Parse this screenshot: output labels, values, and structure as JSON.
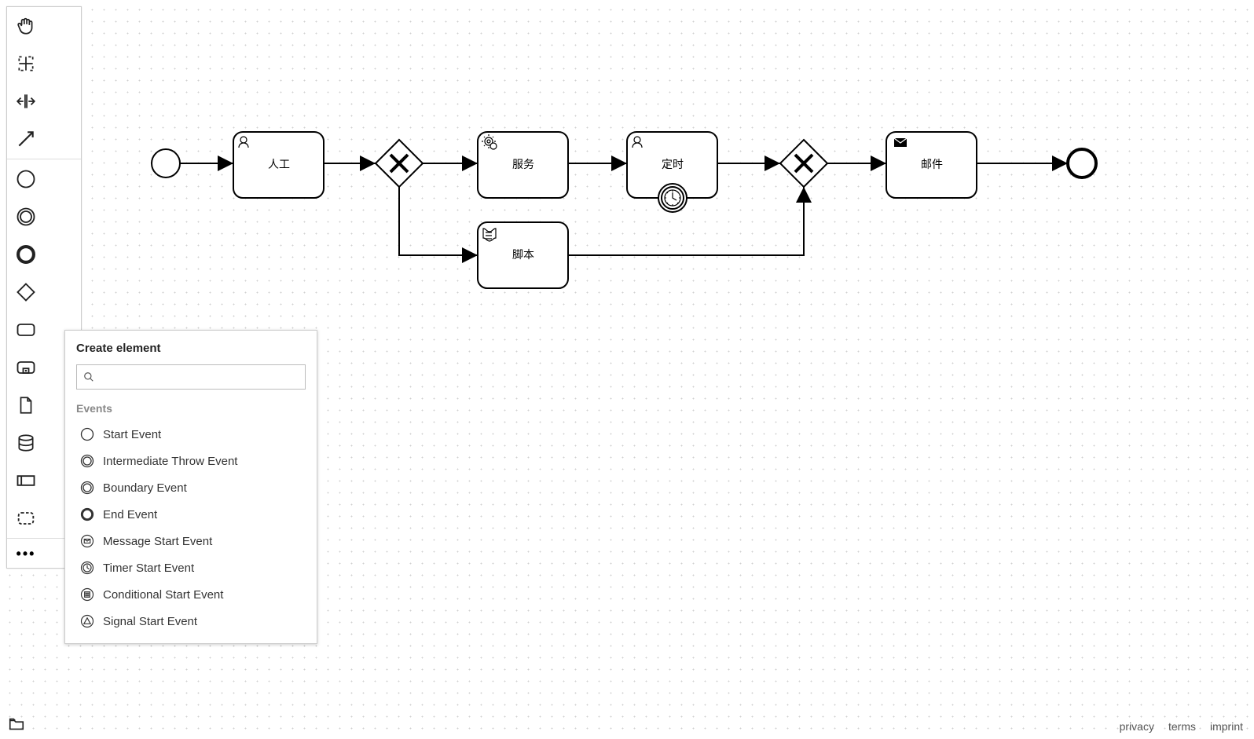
{
  "diagram": {
    "start": {
      "type": "start-event"
    },
    "tasks": [
      {
        "id": "t1",
        "label": "人工",
        "marker": "user"
      },
      {
        "id": "t2",
        "label": "服务",
        "marker": "service"
      },
      {
        "id": "t3",
        "label": "定时",
        "marker": "user",
        "boundary": "timer"
      },
      {
        "id": "t4",
        "label": "脚本",
        "marker": "script"
      },
      {
        "id": "t5",
        "label": "邮件",
        "marker": "message"
      }
    ],
    "gateways": [
      {
        "id": "g1",
        "type": "exclusive"
      },
      {
        "id": "g2",
        "type": "exclusive"
      }
    ],
    "end": {
      "type": "end-event"
    },
    "flows": [
      "start->t1",
      "t1->g1",
      "g1->t2",
      "g1->t4",
      "t2->t3",
      "t3->g2",
      "t4->g2",
      "g2->t5",
      "t5->end"
    ]
  },
  "popup": {
    "title": "Create element",
    "search_placeholder": "",
    "group": "Events",
    "items": [
      {
        "label": "Start Event",
        "icon": "circle-thin"
      },
      {
        "label": "Intermediate Throw Event",
        "icon": "circle-double-thin"
      },
      {
        "label": "Boundary Event",
        "icon": "circle-double-thin"
      },
      {
        "label": "End Event",
        "icon": "circle-thick"
      },
      {
        "label": "Message Start Event",
        "icon": "circle-message"
      },
      {
        "label": "Timer Start Event",
        "icon": "circle-timer"
      },
      {
        "label": "Conditional Start Event",
        "icon": "circle-conditional"
      },
      {
        "label": "Signal Start Event",
        "icon": "circle-signal"
      }
    ]
  },
  "footer": {
    "links": [
      "privacy",
      "terms",
      "imprint"
    ]
  }
}
